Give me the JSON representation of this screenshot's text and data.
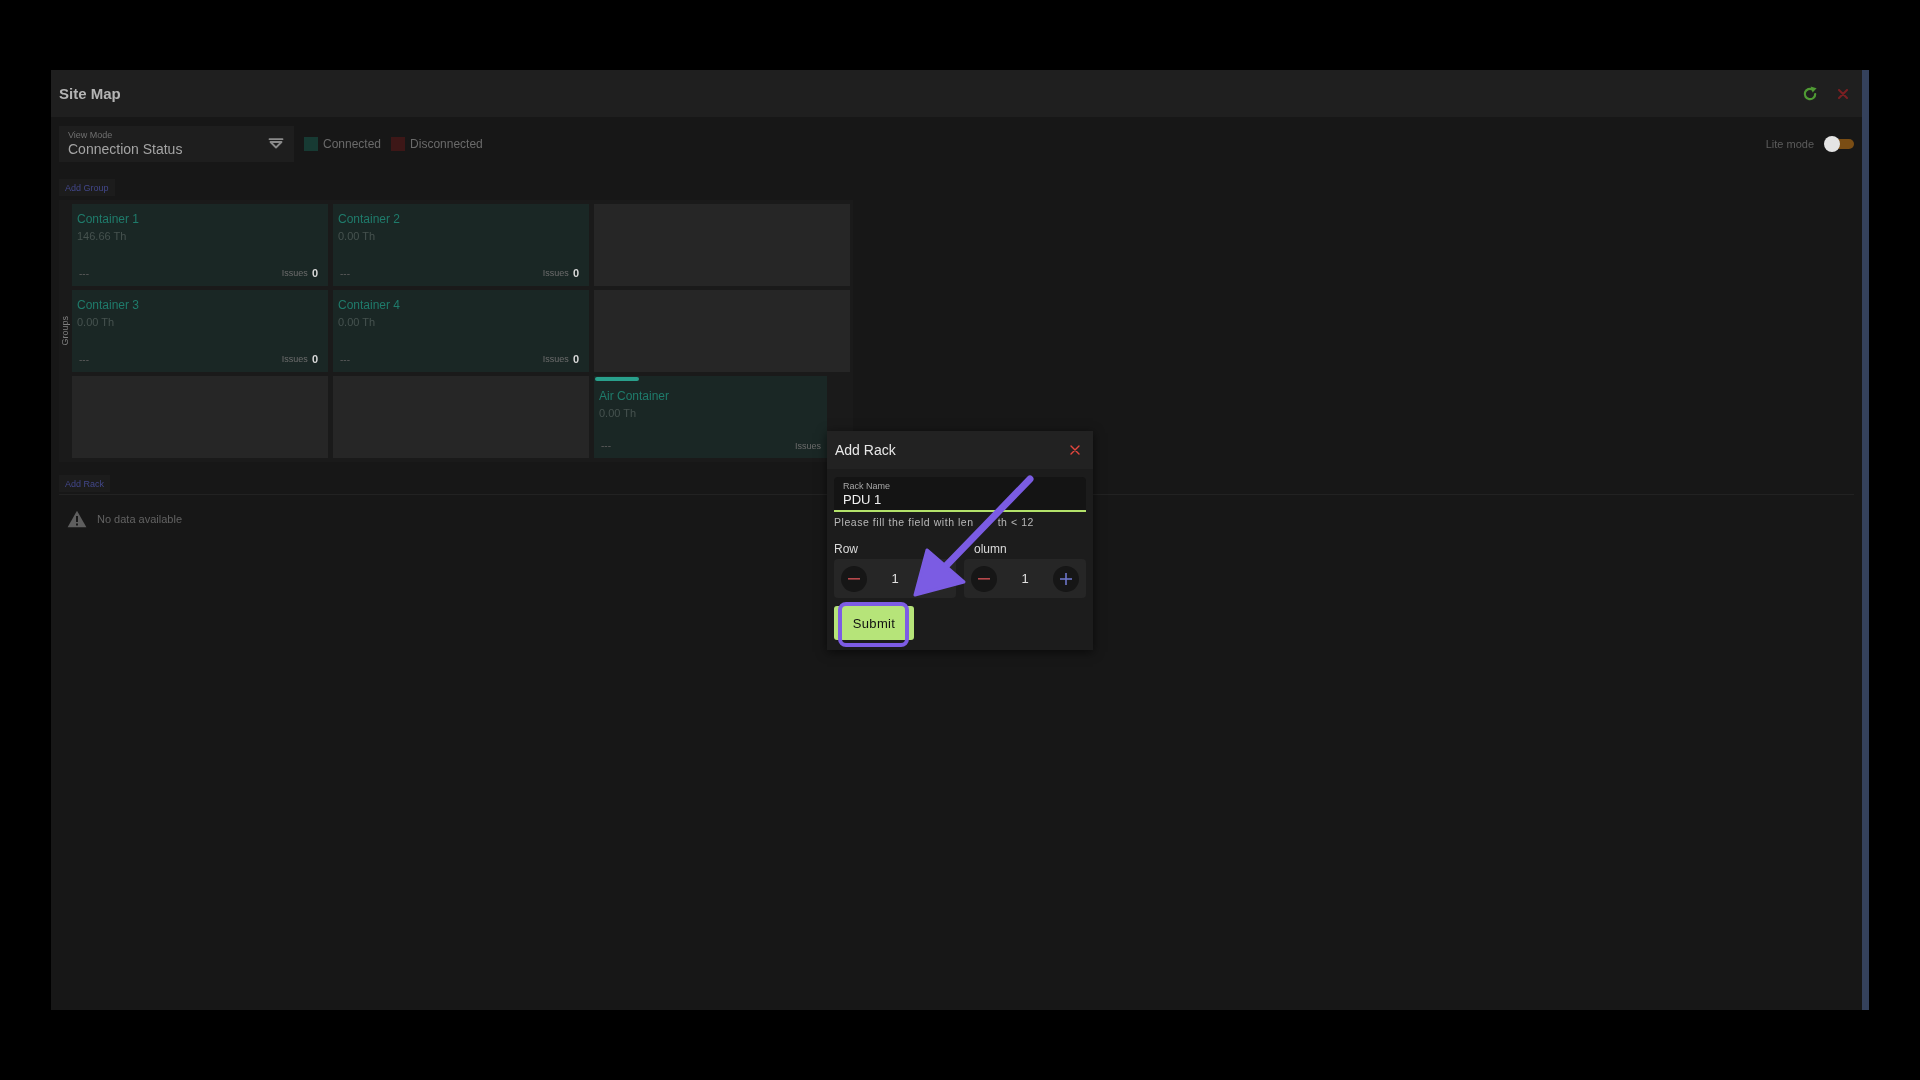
{
  "window": {
    "title": "Site Map"
  },
  "toolbar": {
    "view_mode": {
      "label": "View Mode",
      "value": "Connection Status"
    },
    "legend": [
      {
        "label": "Connected",
        "color": "#173a33"
      },
      {
        "label": "Disconnected",
        "color": "#3d1717"
      }
    ],
    "lite_mode": {
      "label": "Lite mode",
      "on": false
    }
  },
  "add_group_button": "Add Group",
  "groups_panel": {
    "label": "Groups",
    "cells": [
      {
        "kind": "container",
        "title": "Container 1",
        "value": "146.66 Th",
        "status": "---",
        "issues_label": "Issues",
        "issues_count": "0",
        "accent_bar": false,
        "partly_hidden": false
      },
      {
        "kind": "container",
        "title": "Container 2",
        "value": "0.00 Th",
        "status": "---",
        "issues_label": "Issues",
        "issues_count": "0",
        "accent_bar": false,
        "partly_hidden": false
      },
      {
        "kind": "empty"
      },
      {
        "kind": "container",
        "title": "Container 3",
        "value": "0.00 Th",
        "status": "---",
        "issues_label": "Issues",
        "issues_count": "0",
        "accent_bar": false,
        "partly_hidden": false
      },
      {
        "kind": "container",
        "title": "Container 4",
        "value": "0.00 Th",
        "status": "---",
        "issues_label": "Issues",
        "issues_count": "0",
        "accent_bar": false,
        "partly_hidden": false
      },
      {
        "kind": "empty"
      },
      {
        "kind": "empty"
      },
      {
        "kind": "empty"
      },
      {
        "kind": "container",
        "title": "Air Container",
        "value": "0.00 Th",
        "status": "---",
        "issues_label": "Issues",
        "accent_bar": true,
        "partly_hidden": true
      }
    ]
  },
  "add_rack_button": "Add Rack",
  "empty_state": {
    "message": "No data available"
  },
  "dialog": {
    "title": "Add Rack",
    "rack_name": {
      "label": "Rack Name",
      "value": "PDU 1",
      "helper": [
        "Please fill the field with len",
        "th < 12"
      ]
    },
    "row": {
      "label": "Row",
      "value": "1",
      "increment_button": false
    },
    "column": {
      "label": "olumn",
      "value": "1",
      "increment_button": true
    },
    "submit": "Submit"
  },
  "annotation": {
    "arrow": true,
    "submit_highlight": true
  }
}
